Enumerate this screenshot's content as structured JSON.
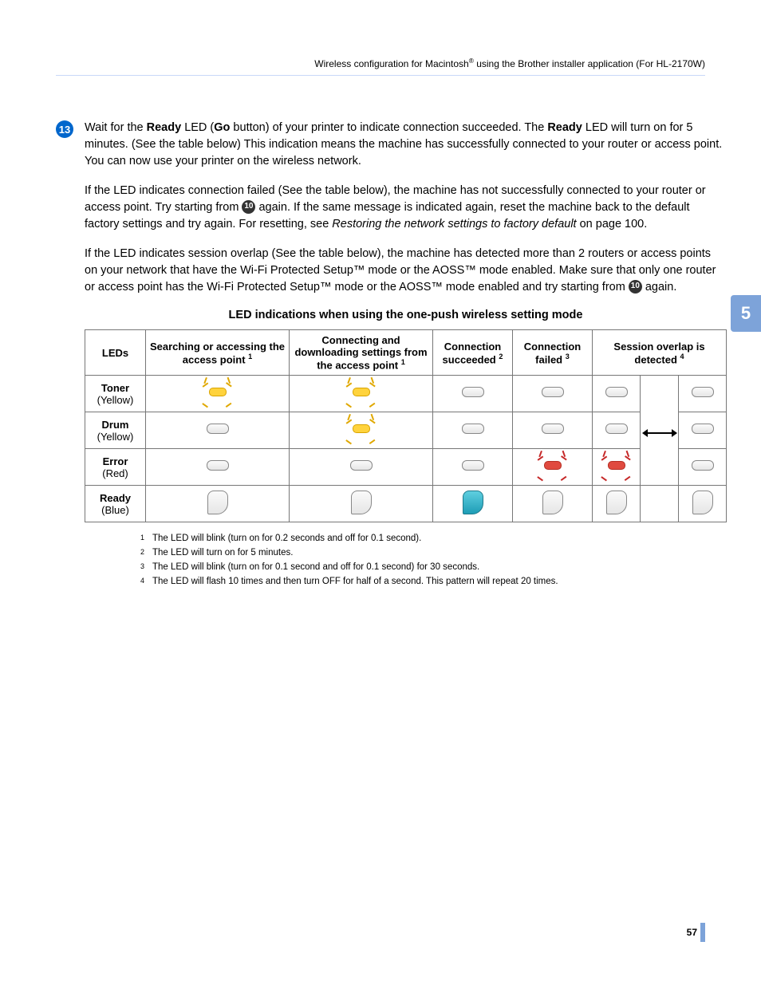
{
  "section_tab": "5",
  "page_number": "57",
  "breadcrumb": {
    "prefix": "Wireless configuration for Macintosh",
    "suffix": " using the Brother installer application (For HL-2170W)"
  },
  "step": {
    "number": "13",
    "p1_a": "Wait for the ",
    "p1_b": "Ready",
    "p1_c": " LED (",
    "p1_d": "Go",
    "p1_e": " button) of your printer to indicate connection succeeded. The ",
    "p1_f": "Ready",
    "p1_g": " LED will turn on for 5 minutes. (See the table below) This indication means the machine has successfully connected to your router or access point. You can now use your printer on the wireless network.",
    "p2_a": "If the LED indicates connection failed (See the table below), the machine has not successfully connected to your router or access point. Try starting from ",
    "p2_ref": "10",
    "p2_b": " again. If the same message is indicated again, reset the machine back to the default factory settings and try again. For resetting, see ",
    "p2_c": "Restoring the network settings to factory default",
    "p2_d": " on page 100.",
    "p3_a": "If the LED indicates session overlap (See the table below), the machine has detected more than 2 routers or access points on your network that have the Wi-Fi Protected Setup™ mode or the AOSS™ mode enabled. Make sure that only one router or access point has the Wi-Fi Protected Setup™ mode or the AOSS™ mode enabled and try starting from ",
    "p3_ref": "10",
    "p3_b": " again."
  },
  "table": {
    "caption": "LED indications when using the one-push wireless setting mode",
    "headers": {
      "leds": "LEDs",
      "searching": "Searching or accessing the access point",
      "searching_fn": "1",
      "connecting": "Connecting and downloading settings from the access point",
      "connecting_fn": "1",
      "succeeded": "Connection succeeded",
      "succeeded_fn": "2",
      "failed": "Connection failed",
      "failed_fn": "3",
      "overlap": "Session overlap is detected",
      "overlap_fn": "4"
    },
    "rows": {
      "toner": {
        "name": "Toner",
        "color": "(Yellow)"
      },
      "drum": {
        "name": "Drum",
        "color": "(Yellow)"
      },
      "error": {
        "name": "Error",
        "color": "(Red)"
      },
      "ready": {
        "name": "Ready",
        "color": "(Blue)"
      }
    }
  },
  "footnotes": {
    "f1": {
      "n": "1",
      "t": "The LED will blink (turn on for 0.2 seconds and off for 0.1 second)."
    },
    "f2": {
      "n": "2",
      "t": "The LED will turn on for 5 minutes."
    },
    "f3": {
      "n": "3",
      "t": "The LED will blink (turn on for 0.1 second and off for 0.1 second) for 30 seconds."
    },
    "f4": {
      "n": "4",
      "t": "The LED will flash 10 times and then turn OFF for half of a second. This pattern will repeat 20 times."
    }
  }
}
